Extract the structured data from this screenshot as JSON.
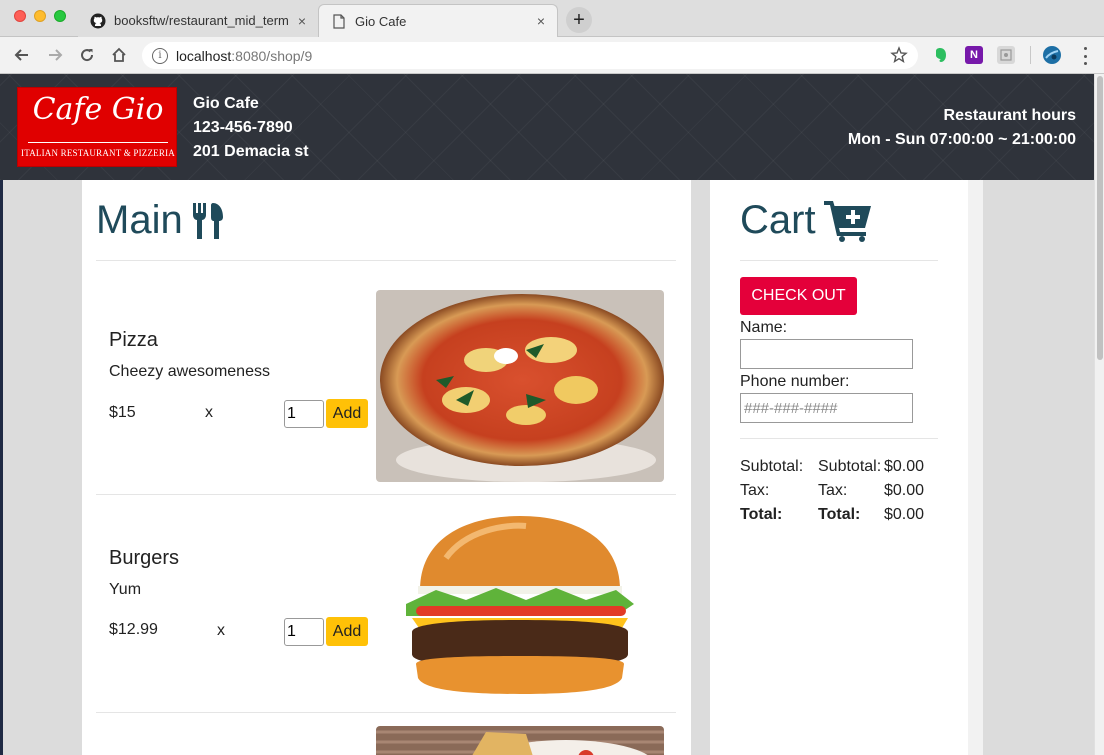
{
  "browser": {
    "tabs": [
      {
        "title": "booksftw/restaurant_mid_term",
        "icon": "github-icon"
      },
      {
        "title": "Gio Cafe",
        "icon": "document-icon"
      }
    ],
    "new_tab": "+",
    "close_glyph": "×",
    "address": {
      "host": "localhost",
      "path": ":8080/shop/9",
      "info_glyph": "i"
    }
  },
  "header": {
    "logo_script": "Cafe Gio",
    "logo_subtitle": "ITALIAN RESTAURANT & PIZZERIA",
    "shop_name": "Gio Cafe",
    "phone": "123-456-7890",
    "address": "201 Demacia st",
    "hours_label": "Restaurant hours",
    "hours": "Mon - Sun 07:00:00 ~ 21:00:00"
  },
  "menu": {
    "title": "Main",
    "items": [
      {
        "name": "Pizza",
        "description": "Cheezy awesomeness",
        "price": "$15",
        "x": "x",
        "qty": "1",
        "add_label": "Add"
      },
      {
        "name": "Burgers",
        "description": "Yum",
        "price": "$12.99",
        "x": "x",
        "qty": "1",
        "add_label": "Add"
      }
    ]
  },
  "cart": {
    "title": "Cart",
    "checkout_label": "CHECK OUT",
    "name_label": "Name:",
    "name_value": "",
    "phone_label": "Phone number:",
    "phone_placeholder": "###-###-####",
    "totals": [
      {
        "label": "Subtotal:",
        "label2": "Subtotal:",
        "value": "$0.00"
      },
      {
        "label": "Tax:",
        "label2": "Tax:",
        "value": "$0.00"
      },
      {
        "label": "Total:",
        "label2": "Total:",
        "value": "$0.00"
      }
    ]
  },
  "colors": {
    "accent": "#1f4a5a",
    "checkout": "#e4003a",
    "add_button": "#ffc107",
    "header_bg": "#2f333b"
  }
}
